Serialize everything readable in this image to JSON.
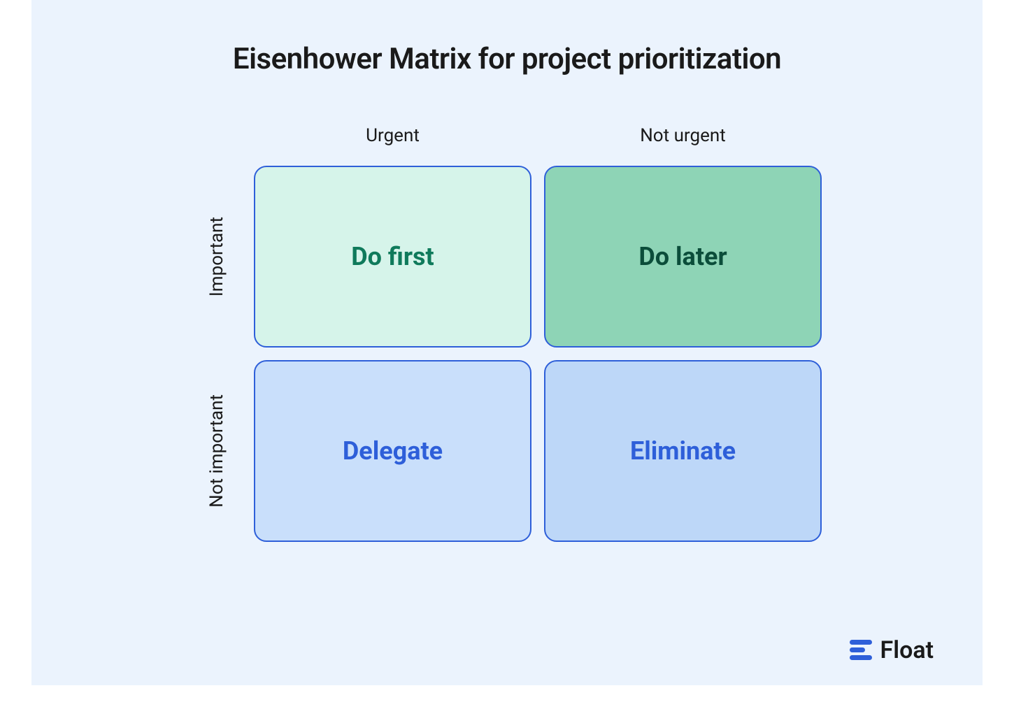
{
  "title": "Eisenhower Matrix for project prioritization",
  "columns": {
    "left": "Urgent",
    "right": "Not urgent"
  },
  "rows": {
    "top": "Important",
    "bottom": "Not important"
  },
  "quadrants": {
    "q1": "Do first",
    "q2": "Do later",
    "q3": "Delegate",
    "q4": "Eliminate"
  },
  "brand": {
    "name": "Float"
  },
  "colors": {
    "background": "#ebf3fd",
    "border": "#2e5fd9",
    "q1_bg": "#d6f4ea",
    "q1_text": "#0f7a5b",
    "q2_bg": "#8ed4b6",
    "q2_text": "#0b4d3a",
    "q3_bg": "#c9dffb",
    "q3_text": "#2e5fd9",
    "q4_bg": "#bdd7f8",
    "q4_text": "#2e5fd9"
  }
}
